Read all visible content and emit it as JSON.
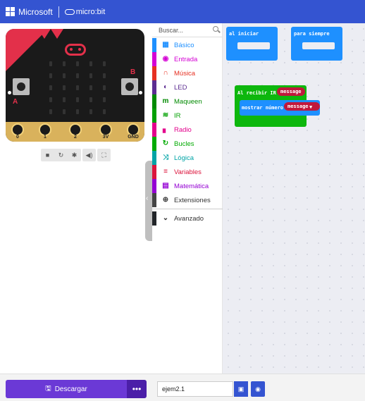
{
  "header": {
    "brand": "Microsoft",
    "product": "micro:bit"
  },
  "simulator": {
    "button_a": "A",
    "button_b": "B",
    "pins": [
      "0",
      "1",
      "2",
      "3V",
      "GND"
    ],
    "controls": [
      "stop",
      "restart",
      "debug",
      "mute",
      "fullscreen"
    ]
  },
  "toolbox": {
    "search_placeholder": "Buscar...",
    "categories": [
      {
        "label": "Básico",
        "color": "#1e90ff",
        "icon": "grid-icon"
      },
      {
        "label": "Entrada",
        "color": "#d400d4",
        "icon": "target-icon"
      },
      {
        "label": "Música",
        "color": "#e63022",
        "icon": "headphones-icon"
      },
      {
        "label": "LED",
        "color": "#5c2d91",
        "icon": "toggle-icon"
      },
      {
        "label": "Maqueen",
        "color": "#008a00",
        "icon": "m-icon"
      },
      {
        "label": "IR",
        "color": "#00a000",
        "icon": "wifi-icon"
      },
      {
        "label": "Radio",
        "color": "#e3008c",
        "icon": "signal-icon"
      },
      {
        "label": "Bucles",
        "color": "#00aa00",
        "icon": "loop-icon"
      },
      {
        "label": "Lógica",
        "color": "#00a4a6",
        "icon": "shuffle-icon"
      },
      {
        "label": "Variables",
        "color": "#dc143c",
        "icon": "list-icon"
      },
      {
        "label": "Matemática",
        "color": "#9400d3",
        "icon": "calculator-icon"
      },
      {
        "label": "Extensiones",
        "color": "#444444",
        "icon": "plus-icon"
      }
    ],
    "advanced": "Avanzado"
  },
  "workspace": {
    "on_start": "al iniciar",
    "forever": "para siempre",
    "on_ir": "Al recibir IR",
    "ir_var": "message",
    "show_number": "mostrar número",
    "show_var": "message"
  },
  "footer": {
    "download": "Descargar",
    "more": "•••",
    "project_name": "ejem2.1"
  }
}
